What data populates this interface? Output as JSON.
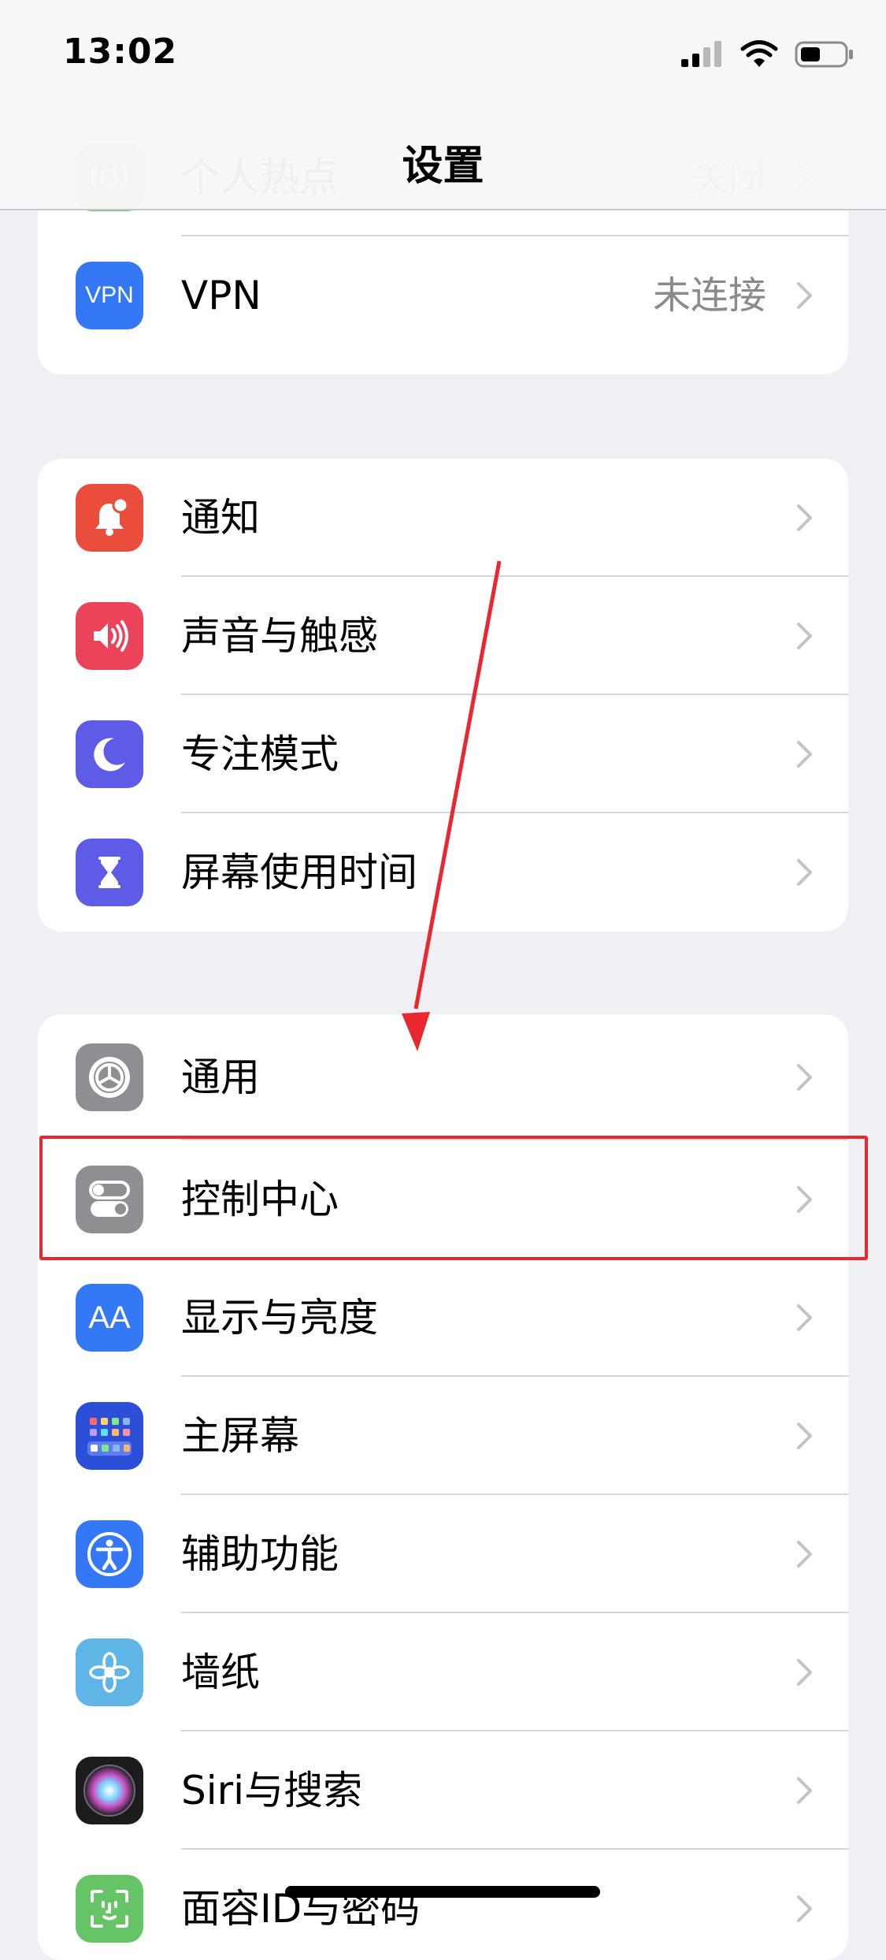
{
  "status_bar": {
    "time": "13:02",
    "signal_icon": "cellular-signal-icon",
    "wifi_icon": "wifi-icon",
    "battery_icon": "battery-icon"
  },
  "nav": {
    "title": "设置"
  },
  "groups": [
    {
      "rows": [
        {
          "label": "个人热点",
          "value": "关闭",
          "icon": "personal-hotspot-icon",
          "color": "#65c466"
        },
        {
          "label": "VPN",
          "value": "未连接",
          "icon": "vpn-icon",
          "icon_text": "VPN",
          "color": "#3478f6"
        }
      ]
    },
    {
      "rows": [
        {
          "label": "通知",
          "icon": "notifications-icon",
          "color": "#eb4d3d"
        },
        {
          "label": "声音与触感",
          "icon": "sounds-haptics-icon",
          "color": "#eb445a"
        },
        {
          "label": "专注模式",
          "icon": "focus-moon-icon",
          "color": "#5e5ce6"
        },
        {
          "label": "屏幕使用时间",
          "icon": "screen-time-hourglass-icon",
          "color": "#5e5ce6"
        }
      ]
    },
    {
      "rows": [
        {
          "label": "通用",
          "icon": "general-gear-icon",
          "color": "#8e8e93"
        },
        {
          "label": "控制中心",
          "icon": "control-center-toggles-icon",
          "color": "#8e8e93"
        },
        {
          "label": "显示与亮度",
          "icon": "display-brightness-icon",
          "icon_text": "AA",
          "color": "#3478f6"
        },
        {
          "label": "主屏幕",
          "icon": "home-screen-icon",
          "color": "#2c4fd8"
        },
        {
          "label": "辅助功能",
          "icon": "accessibility-icon",
          "color": "#3478f6"
        },
        {
          "label": "墙纸",
          "icon": "wallpaper-flower-icon",
          "color": "#5fb5e6"
        },
        {
          "label": "Siri与搜索",
          "icon": "siri-icon",
          "color": "#1c1c1e"
        },
        {
          "label": "面容ID与密码",
          "icon": "face-id-icon",
          "color": "#65c466"
        }
      ]
    }
  ],
  "annotations": {
    "highlight_color": "#e8272e",
    "arrow_color": "#e8272e"
  }
}
